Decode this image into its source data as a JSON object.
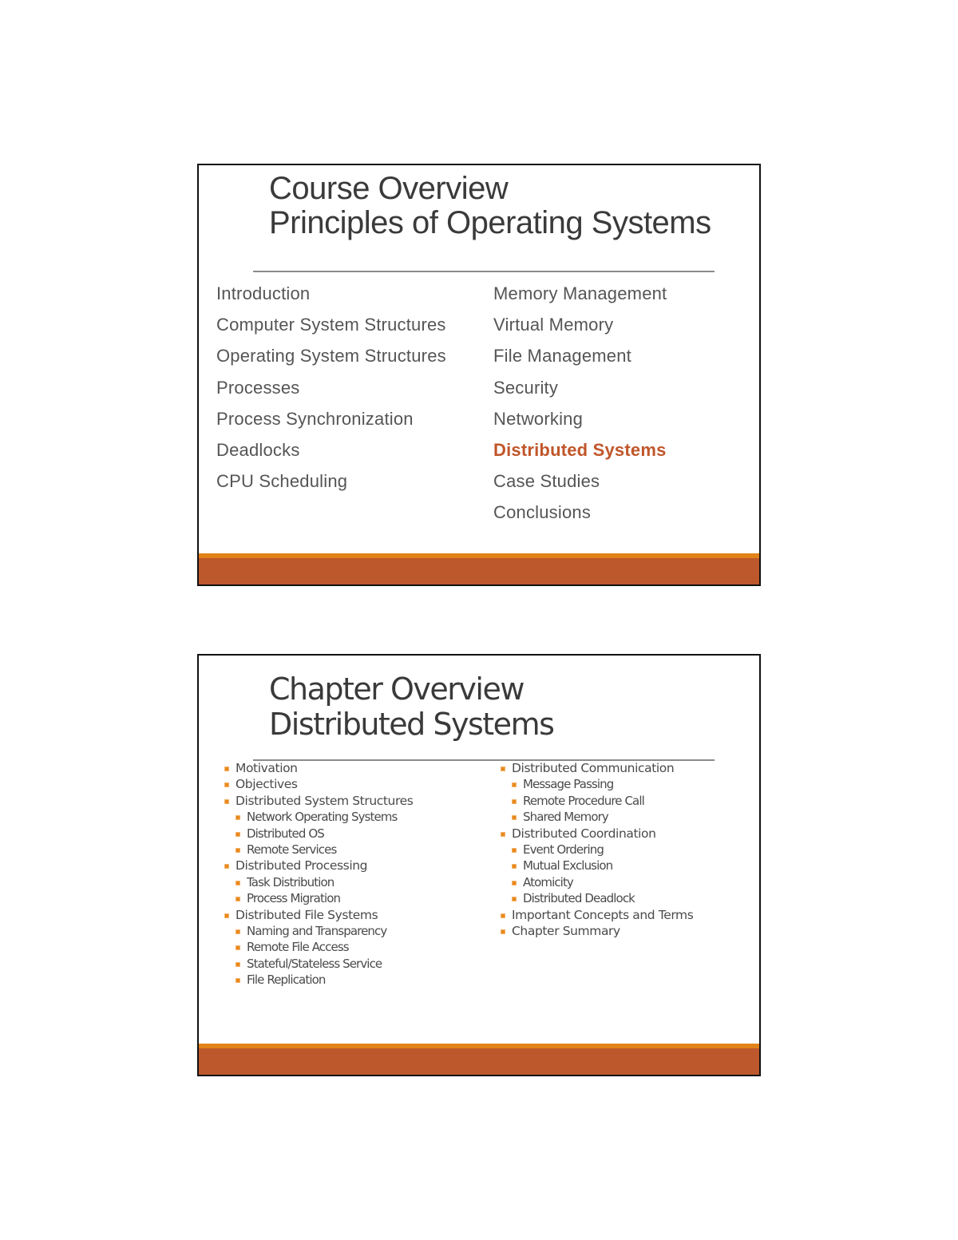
{
  "slides": [
    {
      "title_line1": "Course Overview",
      "title_line2": "Principles of Operating Systems",
      "left_items": [
        "Introduction",
        "Computer System Structures",
        "Operating System Structures",
        "Processes",
        "Process Synchronization",
        "Deadlocks",
        "CPU Scheduling"
      ],
      "right_items": [
        "Memory Management",
        "Virtual Memory",
        "File Management",
        "Security",
        "Networking",
        "Distributed Systems",
        "Case Studies",
        "Conclusions"
      ],
      "highlighted_item": "Distributed Systems",
      "highlight_color": "#c0562a"
    },
    {
      "title_line1": "Chapter Overview",
      "title_line2": "Distributed Systems",
      "left_items": [
        {
          "text": "Motivation",
          "level": 1
        },
        {
          "text": "Objectives",
          "level": 1
        },
        {
          "text": "Distributed System Structures",
          "level": 1
        },
        {
          "text": "Network Operating Systems",
          "level": 2
        },
        {
          "text": "Distributed OS",
          "level": 2
        },
        {
          "text": "Remote Services",
          "level": 2
        },
        {
          "text": "Distributed Processing",
          "level": 1
        },
        {
          "text": "Task Distribution",
          "level": 2
        },
        {
          "text": "Process Migration",
          "level": 2
        },
        {
          "text": "Distributed File Systems",
          "level": 1
        },
        {
          "text": "Naming and Transparency",
          "level": 2
        },
        {
          "text": "Remote File Access",
          "level": 2
        },
        {
          "text": "Stateful/Stateless Service",
          "level": 2
        },
        {
          "text": "File Replication",
          "level": 2
        }
      ],
      "right_items": [
        {
          "text": "Distributed Communication",
          "level": 1
        },
        {
          "text": "Message Passing",
          "level": 2
        },
        {
          "text": "Remote Procedure Call",
          "level": 2
        },
        {
          "text": "Shared Memory",
          "level": 2
        },
        {
          "text": "Distributed Coordination",
          "level": 1
        },
        {
          "text": "Event Ordering",
          "level": 2
        },
        {
          "text": "Mutual Exclusion",
          "level": 2
        },
        {
          "text": "Atomicity",
          "level": 2
        },
        {
          "text": "Distributed Deadlock",
          "level": 2
        },
        {
          "text": "Important Concepts and Terms",
          "level": 1
        },
        {
          "text": "Chapter Summary",
          "level": 1
        }
      ],
      "bullet_color": "#e8891c"
    }
  ],
  "theme": {
    "band_top_color": "#e2831a",
    "band_bottom_color": "#bd582c"
  }
}
